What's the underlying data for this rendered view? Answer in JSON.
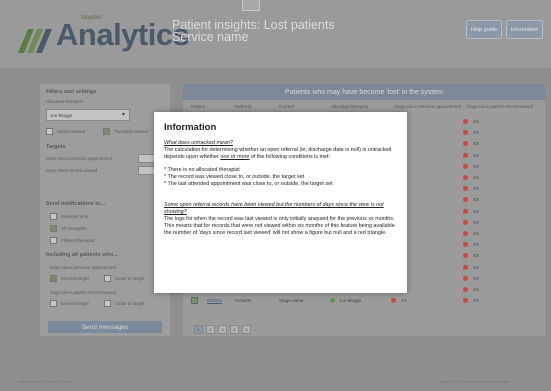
{
  "header": {
    "logo_small": "Mayden",
    "logo_text": "Analytics",
    "title": "Patient insights: Lost patients",
    "subtitle": "Service name",
    "help_label": "Help guide",
    "info_label": "Information"
  },
  "filters": {
    "title": "Filters and settings",
    "allocated_label": "Allocated therapist",
    "allocated_value": "Joe Bloggs",
    "admin_viewed": "Admin viewed",
    "therapist_viewed": "Therapist viewed",
    "targets_title": "Targets",
    "days_prev_appt": "Days since previous appointment",
    "days_record_viewed": "Days since record viewed"
  },
  "notifications": {
    "title": "Send notifications to...",
    "selected_only": "Selected only",
    "all_therapists": "All therapists",
    "filtered_therapist": "Filtered therapist",
    "including_title": "Including all patients who...",
    "days_prev_appt": "Days since previous appointment",
    "exceed_target": "Exceed target",
    "close_to_target": "Close to target",
    "days_record_viewed": "Days since patient record viewed",
    "exceed_target_2": "Exceed target",
    "close_to_target_2": "Close to target",
    "send_button": "Send messages"
  },
  "table": {
    "title": "Patients who may have become 'lost' in the system",
    "columns": [
      "Patient",
      "Referral",
      "Current",
      "Allocated therapist",
      "Days since previous appointment",
      "Days since patient record viewed"
    ],
    "rows": [
      {
        "patient": "",
        "referral": "",
        "stage": "",
        "therapist": "",
        "prev": "XX",
        "viewed": "XX"
      },
      {
        "patient": "",
        "referral": "",
        "stage": "",
        "therapist": "",
        "prev": "XX",
        "viewed": "XX"
      },
      {
        "patient": "",
        "referral": "",
        "stage": "",
        "therapist": "",
        "prev": "XX",
        "viewed": "XX"
      },
      {
        "patient": "",
        "referral": "",
        "stage": "",
        "therapist": "",
        "prev": "XX",
        "viewed": "XX"
      },
      {
        "patient": "",
        "referral": "",
        "stage": "",
        "therapist": "",
        "prev": "XX",
        "viewed": "XX"
      },
      {
        "patient": "",
        "referral": "",
        "stage": "",
        "therapist": "",
        "prev": "XX",
        "viewed": "XX"
      },
      {
        "patient": "",
        "referral": "",
        "stage": "",
        "therapist": "",
        "prev": "XX",
        "viewed": "XX"
      },
      {
        "patient": "",
        "referral": "",
        "stage": "",
        "therapist": "",
        "prev": "XX",
        "viewed": "XX"
      },
      {
        "patient": "",
        "referral": "",
        "stage": "",
        "therapist": "",
        "prev": "XX",
        "viewed": "XX"
      },
      {
        "patient": "",
        "referral": "",
        "stage": "",
        "therapist": "",
        "prev": "XX",
        "viewed": "XX"
      },
      {
        "patient": "",
        "referral": "",
        "stage": "",
        "therapist": "",
        "prev": "XX",
        "viewed": "XX"
      },
      {
        "patient": "",
        "referral": "",
        "stage": "",
        "therapist": "",
        "prev": "XX",
        "viewed": "XX"
      },
      {
        "patient": "",
        "referral": "",
        "stage": "",
        "therapist": "",
        "prev": "XX",
        "viewed": "XX"
      },
      {
        "patient": "",
        "referral": "",
        "stage": "",
        "therapist": "",
        "prev": "XX",
        "viewed": "XX"
      },
      {
        "patient": "",
        "referral": "",
        "stage": "",
        "therapist": "",
        "prev": "XX",
        "viewed": "XX"
      },
      {
        "patient": "000000",
        "referral": "ssrrar00",
        "stage": "Stage name",
        "therapist": "Joe Bloggs",
        "prev": "XX",
        "viewed": "XX"
      },
      {
        "patient": "000000",
        "referral": "ssrrar00",
        "stage": "Stage name",
        "therapist": "Joe Bloggs",
        "prev": "XX",
        "viewed": "XX"
      }
    ],
    "pages": [
      "1",
      "2",
      "3",
      "4",
      "5"
    ],
    "pager_ellipsis": "..."
  },
  "footer": {
    "left": "Data run date: 01-Jan-2019 8:00am",
    "right": "Copyright © 2019 Mayden. All rights reserved."
  },
  "modal": {
    "title": "Information",
    "q1": "What does untracked mean?",
    "p1_a": "The calculation for determining whether an open referral (ie, discharge date is null) is untracked depends upon whether ",
    "p1_u": "one or more",
    "p1_b": " of the following conditions is met:",
    "b1": "* There is no allocated therapist",
    "b2": "* The record was viewed close to, or outside, the target set",
    "b3": "* The last attended appointment was close to, or outside, the target set",
    "q2": "Some open referral records have been viewed but the numbers of days since the view is not showing?",
    "p2": "The logs for when the record was last viewed is only initially anaysed for the previous xx months. This means that for records that were not viewed within six months of this feature being available the number of 'days since record last viewed' will not show a figure but null and a red triangle."
  },
  "colors": {
    "green": "#5e9a44",
    "red": "#c84a3c",
    "accent": "#7d8896"
  }
}
